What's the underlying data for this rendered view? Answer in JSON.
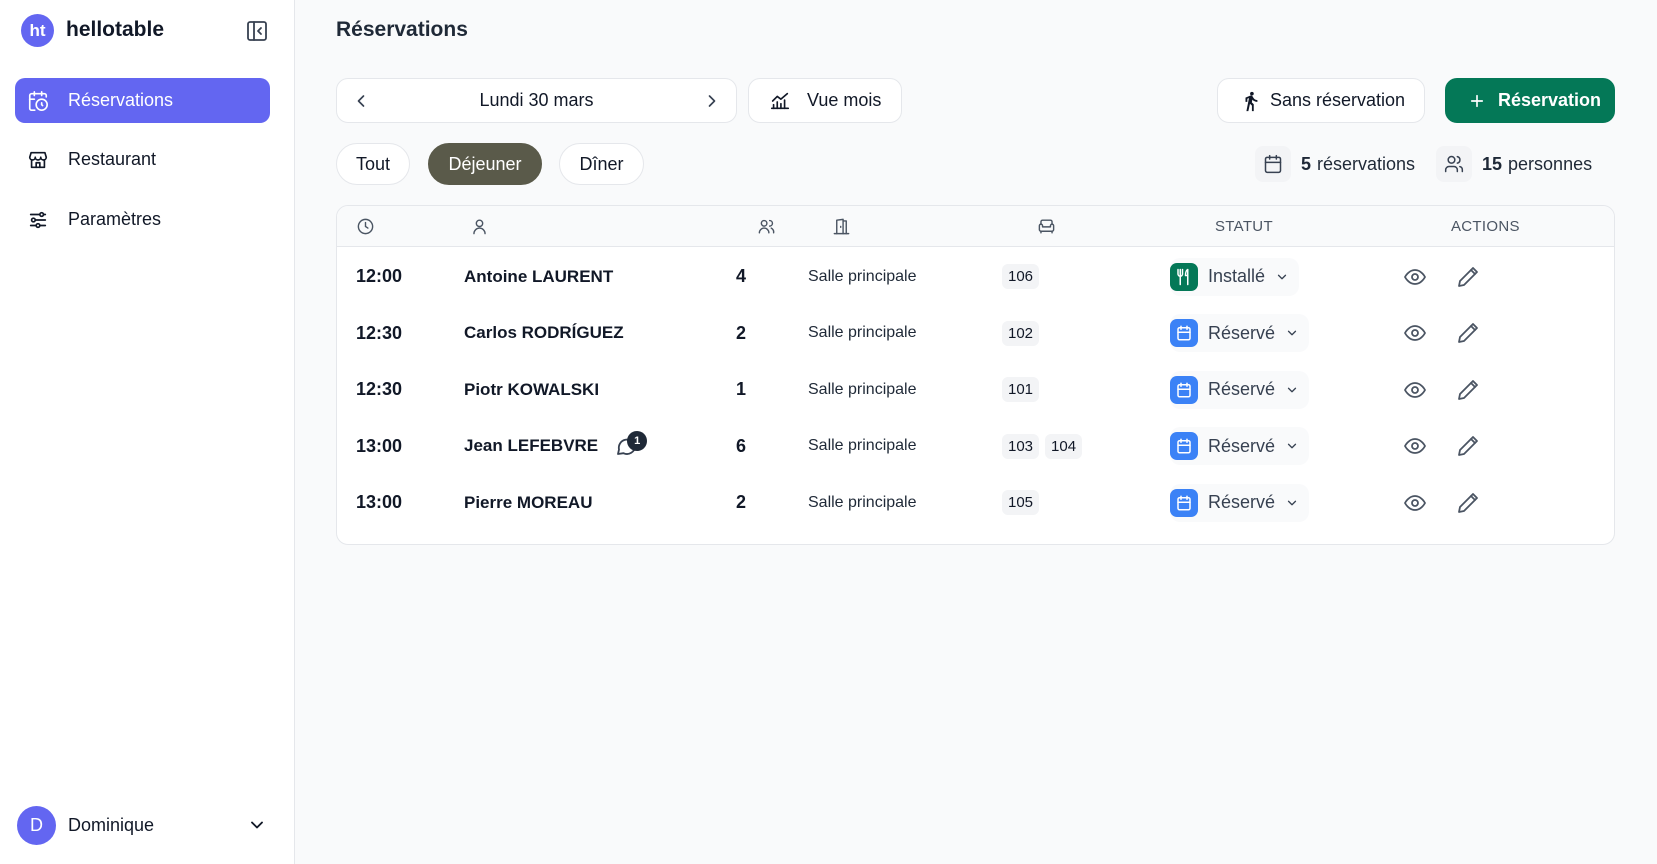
{
  "app": {
    "logo_text": "ht",
    "brand": "hellotable"
  },
  "sidebar": {
    "items": [
      {
        "label": "Réservations",
        "icon": "calendar-clock-icon",
        "active": true
      },
      {
        "label": "Restaurant",
        "icon": "store-icon",
        "active": false
      },
      {
        "label": "Paramètres",
        "icon": "sliders-icon",
        "active": false
      }
    ],
    "user": {
      "initial": "D",
      "name": "Dominique"
    }
  },
  "page": {
    "title": "Réservations"
  },
  "toolbar": {
    "date": "Lundi 30 mars",
    "month_view": "Vue mois",
    "walk_in": "Sans réservation",
    "add": "Réservation"
  },
  "filters": [
    {
      "label": "Tout",
      "active": false
    },
    {
      "label": "Déjeuner",
      "active": true
    },
    {
      "label": "Dîner",
      "active": false
    }
  ],
  "stats": {
    "reservations_count": "5",
    "reservations_label": "réservations",
    "people_count": "15",
    "people_label": "personnes"
  },
  "table": {
    "headers": {
      "status": "STATUT",
      "actions": "ACTIONS"
    },
    "rows": [
      {
        "time": "12:00",
        "name": "Antoine LAURENT",
        "people": "4",
        "room": "Salle principale",
        "tables": [
          "106"
        ],
        "status": "Installé",
        "status_color": "#047857",
        "notes": null
      },
      {
        "time": "12:30",
        "name": "Carlos RODRÍGUEZ",
        "people": "2",
        "room": "Salle principale",
        "tables": [
          "102"
        ],
        "status": "Réservé",
        "status_color": "#3b82f6",
        "notes": null
      },
      {
        "time": "12:30",
        "name": "Piotr KOWALSKI",
        "people": "1",
        "room": "Salle principale",
        "tables": [
          "101"
        ],
        "status": "Réservé",
        "status_color": "#3b82f6",
        "notes": null
      },
      {
        "time": "13:00",
        "name": "Jean LEFEBVRE",
        "people": "6",
        "room": "Salle principale",
        "tables": [
          "103",
          "104"
        ],
        "status": "Réservé",
        "status_color": "#3b82f6",
        "notes": "1"
      },
      {
        "time": "13:00",
        "name": "Pierre MOREAU",
        "people": "2",
        "room": "Salle principale",
        "tables": [
          "105"
        ],
        "status": "Réservé",
        "status_color": "#3b82f6",
        "notes": null
      }
    ]
  },
  "colors": {
    "accent": "#6366f1",
    "primary_green": "#047857",
    "active_filter": "#5a5a4a"
  }
}
